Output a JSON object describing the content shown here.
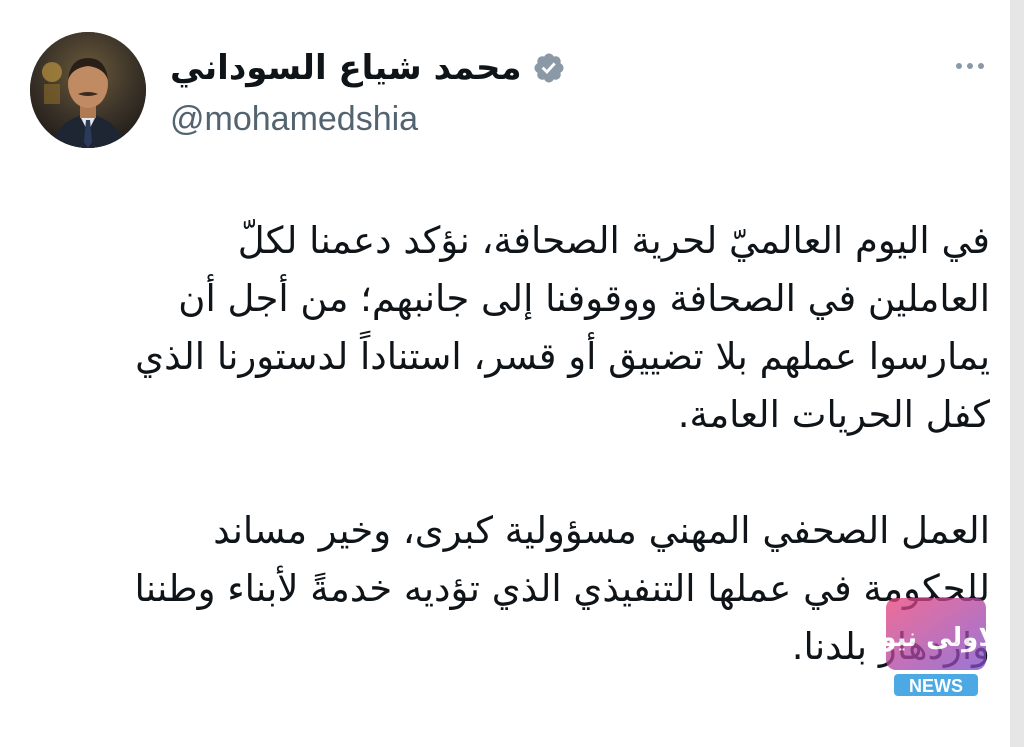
{
  "author": {
    "display_name": "محمد شياع السوداني",
    "handle": "@mohamedshia",
    "verified": true,
    "avatar_icon": "profile-photo"
  },
  "actions": {
    "more_icon": "more-horizontal-icon"
  },
  "tweet": {
    "paragraph_1": "في اليوم العالميّ لحرية الصحافة، نؤكد دعمنا لكلّ\nالعاملين في الصحافة ووقوفنا إلى جانبهم؛ من أجل أن\nيمارسوا عملهم بلا تضييق أو قسر، استناداً لدستورنا الذي\nكفل الحريات العامة.",
    "paragraph_2": "العمل الصحفي المهني مسؤولية كبرى، وخير مساند\nللحكومة في عملها التنفيذي الذي تؤديه خدمةً لأبناء وطننا\nوازدهار بلدنا."
  },
  "watermark": {
    "arabic_text": "الاولى نيوز",
    "latin_text": "NEWS"
  },
  "colors": {
    "text_primary": "#0f1419",
    "text_secondary": "#536471",
    "verified_badge": "#8b98a5",
    "watermark_pink": "#e8407a",
    "watermark_purple": "#7b4dc9",
    "watermark_blue": "#3aa0e0"
  }
}
